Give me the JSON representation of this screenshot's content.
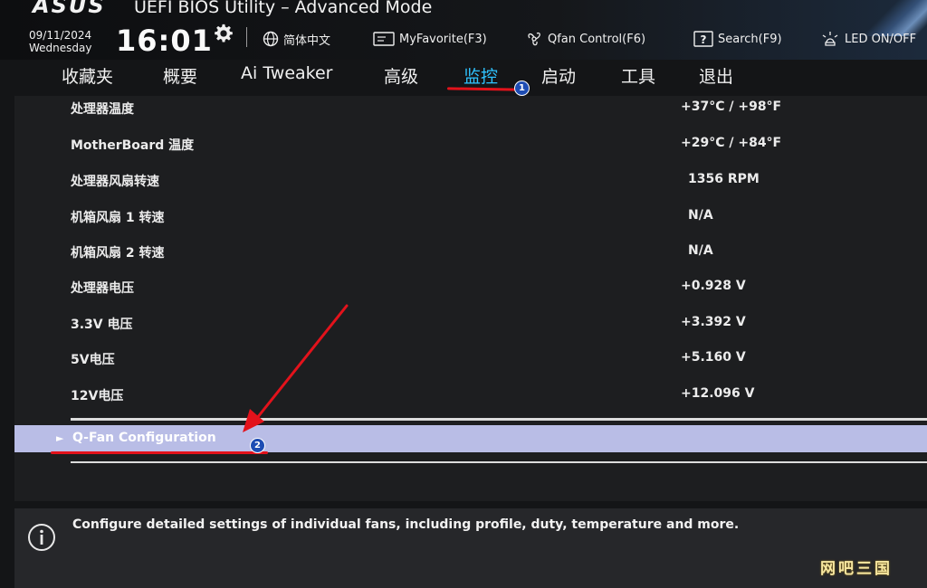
{
  "header": {
    "brand": "ASUS",
    "title": "UEFI BIOS Utility – Advanced Mode",
    "date": "09/11/2024",
    "weekday": "Wednesday",
    "time": "16:01",
    "tools": [
      {
        "label": "简体中文",
        "icon": "globe-icon"
      },
      {
        "label": "MyFavorite(F3)",
        "icon": "favorite-icon"
      },
      {
        "label": "Qfan Control(F6)",
        "icon": "fan-icon"
      },
      {
        "label": "Search(F9)",
        "icon": "search-icon"
      },
      {
        "label": "LED ON/OFF",
        "icon": "led-icon"
      }
    ]
  },
  "menu": {
    "items": [
      "收藏夹",
      "概要",
      "Ai Tweaker",
      "高级",
      "监控",
      "启动",
      "工具",
      "退出"
    ],
    "active": "监控"
  },
  "annotations": {
    "badge1": "1",
    "badge2": "2"
  },
  "monitor": {
    "rows": [
      {
        "label": "处理器温度",
        "value": "+37°C / +98°F"
      },
      {
        "label": "MotherBoard 温度",
        "value": "+29°C / +84°F"
      },
      {
        "label": "处理器风扇转速",
        "value": "1356 RPM"
      },
      {
        "label": "机箱风扇 1 转速",
        "value": "N/A"
      },
      {
        "label": "机箱风扇 2 转速",
        "value": "N/A"
      },
      {
        "label": "处理器电压",
        "value": "+0.928 V"
      },
      {
        "label": "3.3V 电压",
        "value": "+3.392 V"
      },
      {
        "label": "5V电压",
        "value": "+5.160 V"
      },
      {
        "label": "12V电压",
        "value": "+12.096 V"
      }
    ],
    "submenu": "Q-Fan Configuration"
  },
  "help": {
    "text": "Configure detailed settings of individual fans, including profile, duty, temperature and more."
  },
  "watermark": "网吧三国",
  "colors": {
    "accent": "#2fc3ff",
    "annotation": "#e3121b",
    "selected_row": "#b9bde6"
  }
}
